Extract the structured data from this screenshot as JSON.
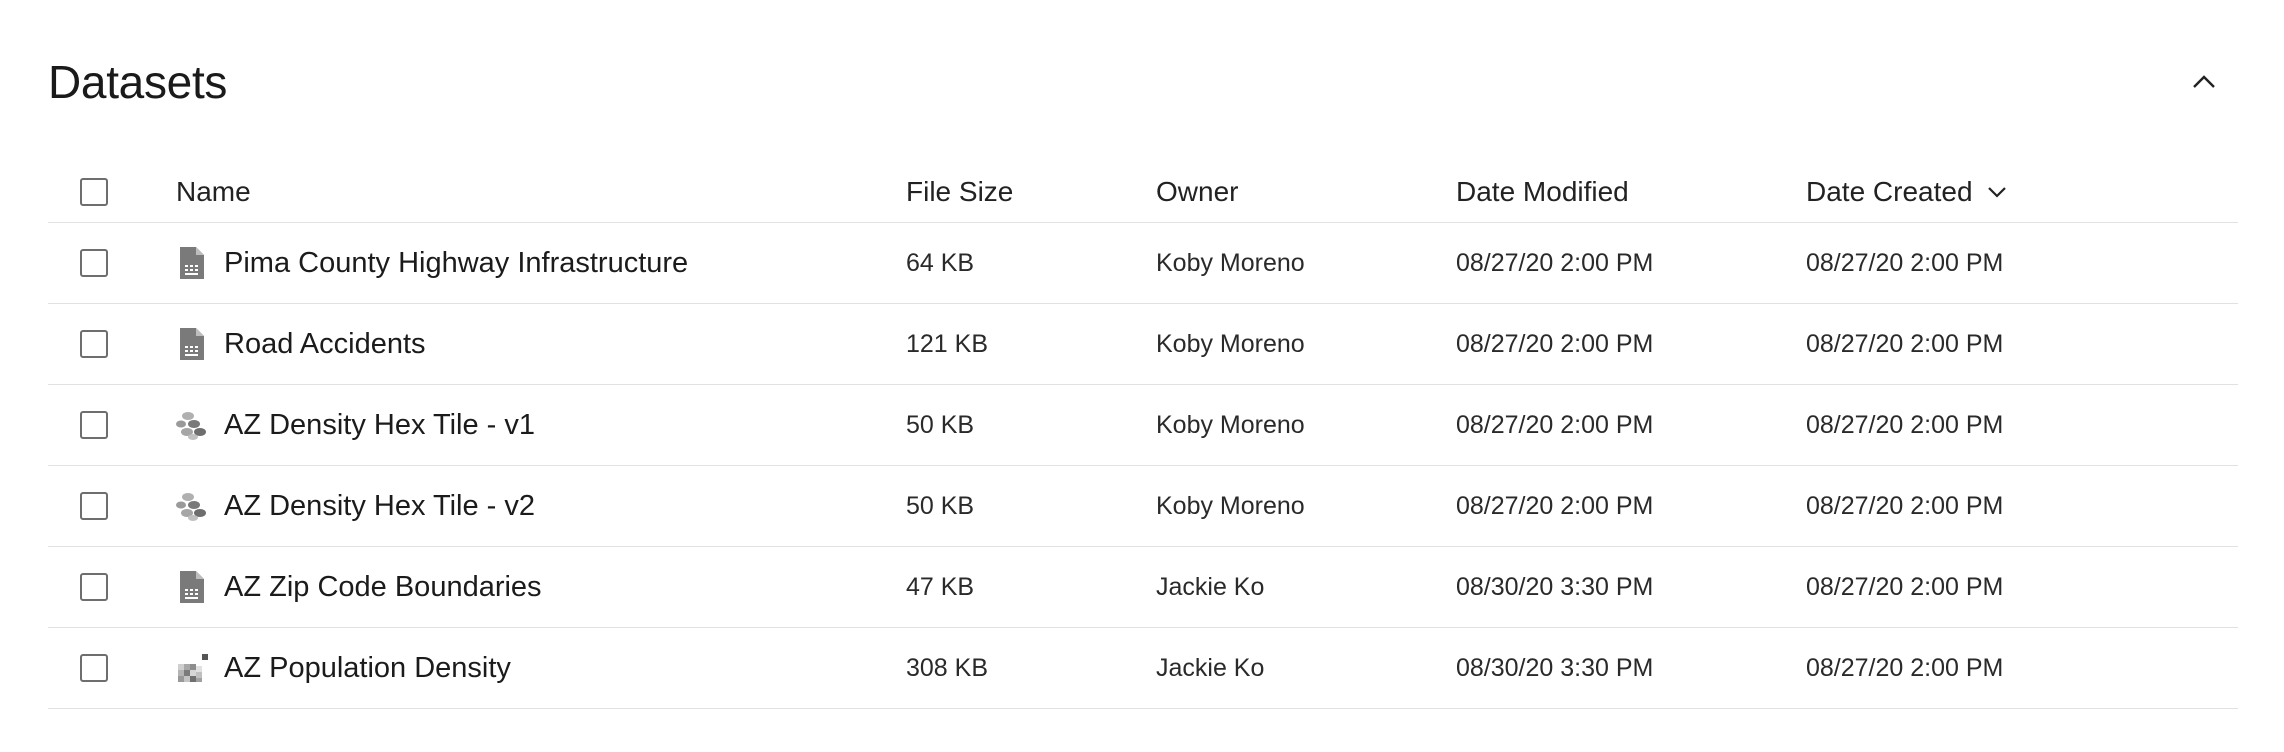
{
  "panel": {
    "title": "Datasets"
  },
  "columns": {
    "name": "Name",
    "file_size": "File Size",
    "owner": "Owner",
    "date_modified": "Date Modified",
    "date_created": "Date Created"
  },
  "rows": [
    {
      "name": "Pima County Highway Infrastructure",
      "icon": "document-icon",
      "file_size": "64 KB",
      "owner": "Koby Moreno",
      "date_modified": "08/27/20 2:00 PM",
      "date_created": "08/27/20 2:00 PM"
    },
    {
      "name": "Road Accidents",
      "icon": "document-icon",
      "file_size": "121 KB",
      "owner": "Koby Moreno",
      "date_modified": "08/27/20 2:00 PM",
      "date_created": "08/27/20 2:00 PM"
    },
    {
      "name": "AZ Density Hex Tile - v1",
      "icon": "hex-tile-icon",
      "file_size": "50 KB",
      "owner": "Koby Moreno",
      "date_modified": "08/27/20 2:00 PM",
      "date_created": "08/27/20 2:00 PM"
    },
    {
      "name": "AZ Density Hex Tile - v2",
      "icon": "hex-tile-icon",
      "file_size": "50 KB",
      "owner": "Koby Moreno",
      "date_modified": "08/27/20 2:00 PM",
      "date_created": "08/27/20 2:00 PM"
    },
    {
      "name": "AZ Zip Code Boundaries",
      "icon": "document-icon",
      "file_size": "47 KB",
      "owner": "Jackie Ko",
      "date_modified": "08/30/20 3:30 PM",
      "date_created": "08/27/20 2:00 PM"
    },
    {
      "name": "AZ Population Density",
      "icon": "raster-grid-icon",
      "file_size": "308 KB",
      "owner": "Jackie Ko",
      "date_modified": "08/30/20 3:30 PM",
      "date_created": "08/27/20 2:00 PM"
    }
  ],
  "colors": {
    "text": "#1b1b1b",
    "divider": "#e1e1e1",
    "icon": "#7a7a7a",
    "checkbox_border": "#6e6e6e"
  }
}
